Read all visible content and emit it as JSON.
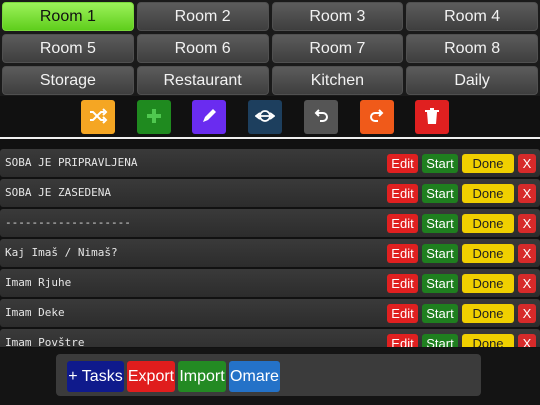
{
  "rooms": [
    {
      "label": "Room 1",
      "active": true
    },
    {
      "label": "Room 2"
    },
    {
      "label": "Room 3"
    },
    {
      "label": "Room 4"
    },
    {
      "label": "Room 5"
    },
    {
      "label": "Room 6"
    },
    {
      "label": "Room 7"
    },
    {
      "label": "Room 8"
    },
    {
      "label": "Storage"
    },
    {
      "label": "Restaurant"
    },
    {
      "label": "Kitchen"
    },
    {
      "label": "Daily"
    }
  ],
  "toolbar": {
    "buttons": [
      {
        "icon": "shuffle-icon",
        "color": "#f5a623"
      },
      {
        "icon": "plus-icon",
        "color": "#1f8a1f"
      },
      {
        "icon": "pencil-icon",
        "color": "#6a2cf0"
      },
      {
        "icon": "move-arrows-icon",
        "color": "#1d3f5e"
      },
      {
        "icon": "undo-icon",
        "color": "#555555"
      },
      {
        "icon": "redo-icon",
        "color": "#f05a1a"
      },
      {
        "icon": "trash-icon",
        "color": "#e02020"
      }
    ]
  },
  "task_buttons": {
    "edit": "Edit",
    "start": "Start",
    "done": "Done",
    "delete": "X"
  },
  "tasks": [
    {
      "text": "SOBA JE PRIPRAVLJENA"
    },
    {
      "text": "SOBA JE ZASEDENA"
    },
    {
      "text": "-------------------"
    },
    {
      "text": "Kaj Imaš / Nimaš?"
    },
    {
      "text": "Imam Rjuhe"
    },
    {
      "text": "Imam Deke"
    },
    {
      "text": "Imam Povštre"
    }
  ],
  "bottom": {
    "tasks": "+ Tasks",
    "export": "Export",
    "import": "Import",
    "omare": "Omare"
  },
  "colors": {
    "active_room": "#7ad93b",
    "edit": "#e02020",
    "start": "#1f7f1f",
    "done": "#f0d000",
    "delete": "#d72a2a"
  }
}
